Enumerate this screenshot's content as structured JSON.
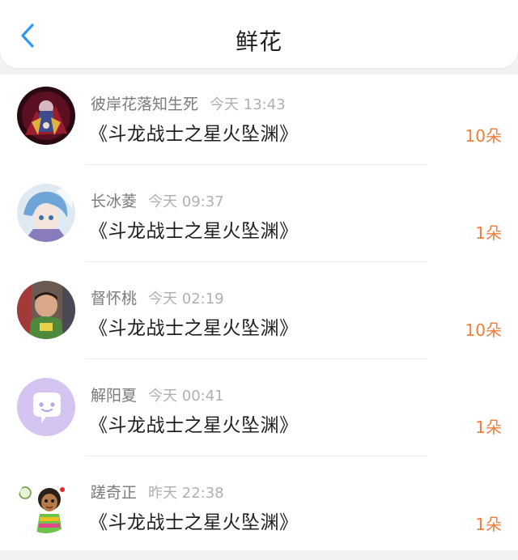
{
  "header": {
    "title": "鲜花",
    "back_icon": "chevron-left-icon",
    "accent_color": "#2b9af3"
  },
  "colors": {
    "count": "#f07f3c",
    "name": "#7a7a7a",
    "time": "#b0b0b0"
  },
  "items": [
    {
      "user": "彼岸花落知生死",
      "time": "今天 13:43",
      "book": "《斗龙战士之星火坠渊》",
      "count": "10朵",
      "avatar": "anime-dark-avatar"
    },
    {
      "user": "长冰菱",
      "time": "今天 09:37",
      "book": "《斗龙战士之星火坠渊》",
      "count": "1朵",
      "avatar": "anime-blue-hair-avatar"
    },
    {
      "user": "督怀桃",
      "time": "今天 02:19",
      "book": "《斗龙战士之星火坠渊》",
      "count": "10朵",
      "avatar": "child-photo-avatar"
    },
    {
      "user": "解阳夏",
      "time": "今天 00:41",
      "book": "《斗龙战士之星火坠渊》",
      "count": "1朵",
      "avatar": "default-chat-avatar"
    },
    {
      "user": "蹉奇正",
      "time": "昨天 22:38",
      "book": "《斗龙战士之星火坠渊》",
      "count": "1朵",
      "avatar": "cartoon-girl-avatar"
    }
  ]
}
